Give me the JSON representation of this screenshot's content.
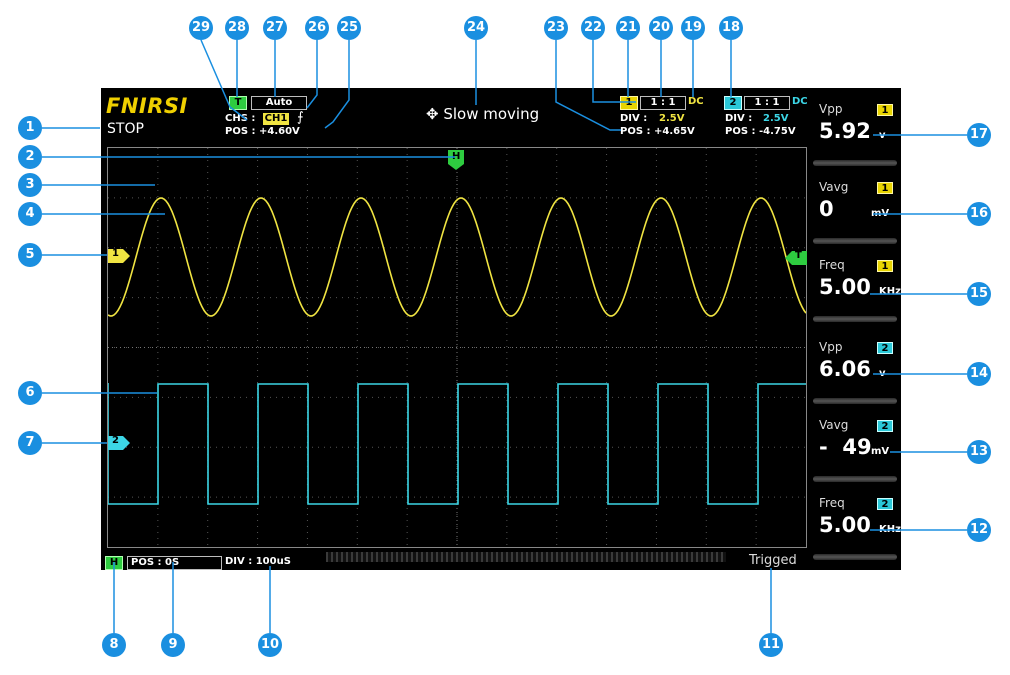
{
  "brand": "FNIRSI",
  "run_state": "STOP",
  "trigger": {
    "badge": "T",
    "mode": "Auto",
    "chs_label": "CHS :",
    "channel": "CH1",
    "edge_symbol": "⨍",
    "pos_label": "POS : +4.60V"
  },
  "status_message": "✥ Slow moving",
  "ch1": {
    "badge": "1",
    "probe": "1 : 1",
    "coupling": "DC",
    "div_label": "DIV :",
    "div_value": "2.5V",
    "pos_label": "POS : +4.65V",
    "marker": "1"
  },
  "ch2": {
    "badge": "2",
    "probe": "1 : 1",
    "coupling": "DC",
    "div_label": "DIV :",
    "div_value": "2.5V",
    "pos_label": "POS : -4.75V",
    "marker": "2"
  },
  "h_marker": "H",
  "t_marker": "T",
  "timebase": {
    "badge": "H",
    "pos": "POS : 0S",
    "div": "DIV : 100uS"
  },
  "trig_status": "Trigged",
  "measurements": [
    {
      "label": "Vpp",
      "channel": "1",
      "value": "5.92",
      "unit": "v"
    },
    {
      "label": "Vavg",
      "channel": "1",
      "value": "0",
      "unit": "mV"
    },
    {
      "label": "Freq",
      "channel": "1",
      "value": "5.00",
      "unit": "KHz"
    },
    {
      "label": "Vpp",
      "channel": "2",
      "value": "6.06",
      "unit": "v"
    },
    {
      "label": "Vavg",
      "channel": "2",
      "value": "-  49",
      "unit": "mV"
    },
    {
      "label": "Freq",
      "channel": "2",
      "value": "5.00",
      "unit": "KHz"
    }
  ],
  "waveforms": {
    "ch1": {
      "shape": "sine",
      "cycles": 6.2,
      "color": "#f0e442"
    },
    "ch2": {
      "shape": "square",
      "cycles": 6.2,
      "color": "#3cd6e6"
    }
  },
  "colors": {
    "ch1": "#f0e442",
    "ch2": "#3cd6e6",
    "trigger": "#2ecc40",
    "brand": "#f0d000",
    "callout": "#1a8fe0"
  },
  "callouts": [
    "1",
    "2",
    "3",
    "4",
    "5",
    "6",
    "7",
    "8",
    "9",
    "10",
    "11",
    "12",
    "13",
    "14",
    "15",
    "16",
    "17",
    "18",
    "19",
    "20",
    "21",
    "22",
    "23",
    "24",
    "25",
    "26",
    "27",
    "28",
    "29"
  ]
}
